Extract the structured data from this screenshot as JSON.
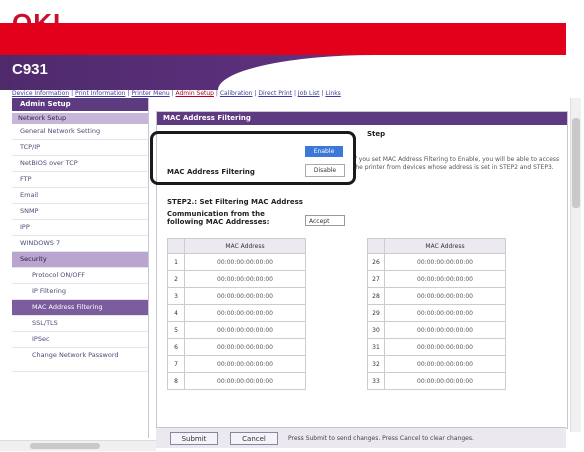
{
  "header": {
    "logo": "OKI",
    "model": "C931"
  },
  "nav_links": [
    {
      "label": "Device Information"
    },
    {
      "label": "Print Information"
    },
    {
      "label": "Printer Menu"
    },
    {
      "label": "Admin Setup",
      "active": true
    },
    {
      "label": "Calibration"
    },
    {
      "label": "Direct Print"
    },
    {
      "label": "Job List"
    },
    {
      "label": "Links"
    }
  ],
  "sidebar": {
    "title": "Admin Setup",
    "section": "Network Setup",
    "items": [
      {
        "label": "General Network Setting"
      },
      {
        "label": "TCP/IP"
      },
      {
        "label": "NetBIOS over TCP"
      },
      {
        "label": "FTP"
      },
      {
        "label": "Email"
      },
      {
        "label": "SNMP"
      },
      {
        "label": "IPP"
      },
      {
        "label": "WINDOWS 7"
      },
      {
        "label": "Security",
        "selected": true
      },
      {
        "label": "Protocol ON/OFF"
      },
      {
        "label": "IP Filtering"
      },
      {
        "label": "MAC Address Filtering",
        "current": true
      },
      {
        "label": "SSL/TLS"
      },
      {
        "label": "IPSec"
      },
      {
        "label": "Change Network Password"
      }
    ]
  },
  "content": {
    "title": "MAC Address Filtering",
    "step1": "Step",
    "filter_label": "MAC Address Filtering",
    "option_enable": "Enable",
    "option_disable": "Disable",
    "description": "If you set MAC Address Filtering to Enable, you will be able to access the printer from devices whose address is set in STEP2 and STEP3.",
    "step2_title": "STEP2.: Set Filtering MAC Address",
    "comm_label": "Communication from the following MAC Addresses:",
    "comm_value": "Accept",
    "table_header": "MAC Address",
    "left_rows": [
      {
        "n": "1",
        "addr": "00:00:00:00:00:00"
      },
      {
        "n": "2",
        "addr": "00:00:00:00:00:00"
      },
      {
        "n": "3",
        "addr": "00:00:00:00:00:00"
      },
      {
        "n": "4",
        "addr": "00:00:00:00:00:00"
      },
      {
        "n": "5",
        "addr": "00:00:00:00:00:00"
      },
      {
        "n": "6",
        "addr": "00:00:00:00:00:00"
      },
      {
        "n": "7",
        "addr": "00:00:00:00:00:00"
      },
      {
        "n": "8",
        "addr": "00:00:00:00:00:00"
      }
    ],
    "right_rows": [
      {
        "n": "26",
        "addr": "00:00:00:00:00:00"
      },
      {
        "n": "27",
        "addr": "00:00:00:00:00:00"
      },
      {
        "n": "28",
        "addr": "00:00:00:00:00:00"
      },
      {
        "n": "29",
        "addr": "00:00:00:00:00:00"
      },
      {
        "n": "30",
        "addr": "00:00:00:00:00:00"
      },
      {
        "n": "31",
        "addr": "00:00:00:00:00:00"
      },
      {
        "n": "32",
        "addr": "00:00:00:00:00:00"
      },
      {
        "n": "33",
        "addr": "00:00:00:00:00:00"
      }
    ]
  },
  "footer": {
    "submit": "Submit",
    "cancel": "Cancel",
    "note": "Press Submit to send changes. Press Cancel to clear changes."
  }
}
